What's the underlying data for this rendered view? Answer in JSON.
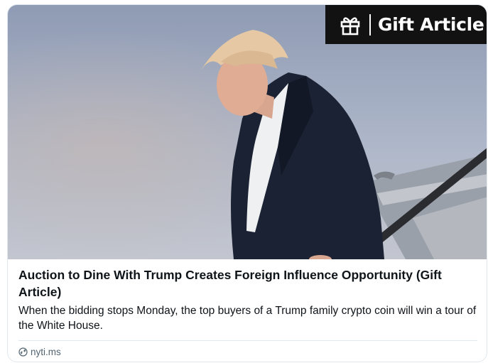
{
  "card": {
    "badge_label": "Gift Article",
    "image_alt": "Man in dark suit descending aircraft stairs",
    "title": "Auction to Dine With Trump Creates Foreign Influence Opportunity (Gift Article)",
    "description": "When the bidding stops Monday, the top buyers of a Trump family crypto coin will win a tour of the White House.",
    "source": "nyti.ms"
  },
  "icons": {
    "gift": "gift-icon",
    "link": "link-icon"
  },
  "colors": {
    "badge_bg": "#121212",
    "badge_text": "#ffffff",
    "title_text": "#0f1419",
    "source_text": "#536471",
    "border": "#e1e8ed"
  }
}
